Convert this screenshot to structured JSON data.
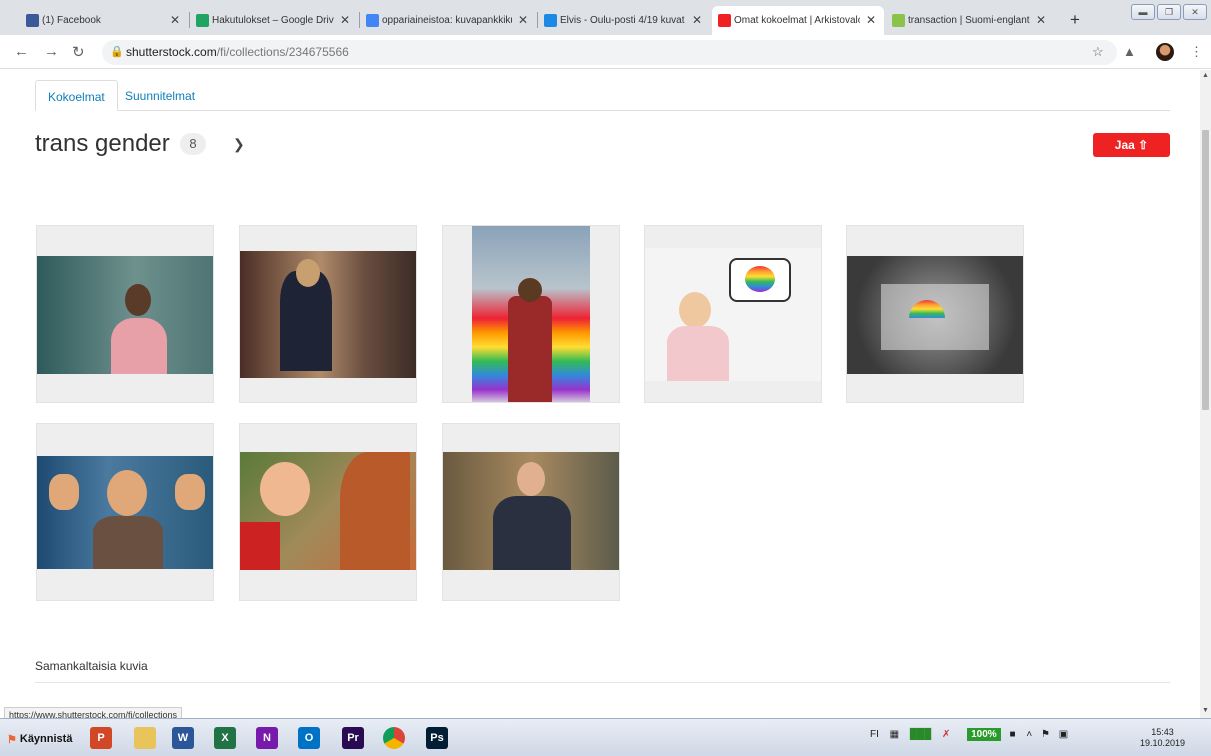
{
  "browser": {
    "tabs": [
      {
        "title": "(1) Facebook",
        "favicon": "facebook-icon",
        "color": "#3b5998",
        "active": false
      },
      {
        "title": "Hakutulokset – Google Drive",
        "favicon": "google-drive-icon",
        "color": "#1fa463",
        "active": false
      },
      {
        "title": "oppariaineistoa: kuvapankkiku",
        "favicon": "google-docs-icon",
        "color": "#4285f4",
        "active": false
      },
      {
        "title": "Elvis - Oulu-posti 4/19 kuvat",
        "favicon": "v-logo-icon",
        "color": "#1e88e5",
        "active": false
      },
      {
        "title": "Omat kokoelmat | Arkistovalo",
        "favicon": "shutterstock-icon",
        "color": "#e22",
        "active": true
      },
      {
        "title": "transaction | Suomi-englanti s",
        "favicon": "dictionary-icon",
        "color": "#8bc34a",
        "active": false
      }
    ],
    "new_tab_label": "+",
    "url_host": "shutterstock.com",
    "url_path": "/fi/collections/234675566"
  },
  "page": {
    "tabs": [
      {
        "label": "Kokoelmat",
        "active": true
      },
      {
        "label": "Suunnitelmat",
        "active": false
      }
    ],
    "collection_title": "trans gender",
    "count": "8",
    "share_label": "Jaa",
    "similar_title": "Samankaltaisia kuvia",
    "status_url": "https://www.shutterstock.com/fi/collections"
  },
  "images": [
    {
      "name": "photo-portrait-woman",
      "colors": [
        "#3d6b6c",
        "#7b9a96"
      ]
    },
    {
      "name": "photo-woman-mirror",
      "colors": [
        "#3a2a25",
        "#c0a080"
      ]
    },
    {
      "name": "photo-rainbow-crosswalk",
      "colors": [
        "#9ab0c8",
        "#d8d0c0"
      ]
    },
    {
      "name": "photo-boy-heart-bubble",
      "colors": [
        "#f2f2f2",
        "#e8c8c8"
      ]
    },
    {
      "name": "photo-rainbow-window",
      "colors": [
        "#3a3a3a",
        "#8a8a8a"
      ]
    },
    {
      "name": "photo-laughing-child",
      "colors": [
        "#2a4a6a",
        "#d0a070"
      ]
    },
    {
      "name": "photo-children-sand",
      "colors": [
        "#c86a3a",
        "#a08060"
      ]
    },
    {
      "name": "photo-boy-jacket",
      "colors": [
        "#8a6a4a",
        "#3a4050"
      ]
    }
  ],
  "taskbar": {
    "start_label": "Käynnistä",
    "apps": [
      {
        "name": "powerpoint-icon",
        "letter": "P",
        "color": "#d24726"
      },
      {
        "name": "file-explorer-icon",
        "letter": "",
        "color": "#e8c45a"
      },
      {
        "name": "word-icon",
        "letter": "W",
        "color": "#2b579a"
      },
      {
        "name": "excel-icon",
        "letter": "X",
        "color": "#217346"
      },
      {
        "name": "onenote-icon",
        "letter": "N",
        "color": "#7719aa"
      },
      {
        "name": "outlook-icon",
        "letter": "O",
        "color": "#0072c6"
      },
      {
        "name": "premiere-icon",
        "letter": "Pr",
        "color": "#2a0a52"
      },
      {
        "name": "chrome-icon",
        "letter": "",
        "color": "#db4437"
      },
      {
        "name": "photoshop-icon",
        "letter": "Ps",
        "color": "#001d34"
      }
    ],
    "language": "FI",
    "battery": "100%",
    "time": "15:43",
    "date": "19.10.2019"
  }
}
